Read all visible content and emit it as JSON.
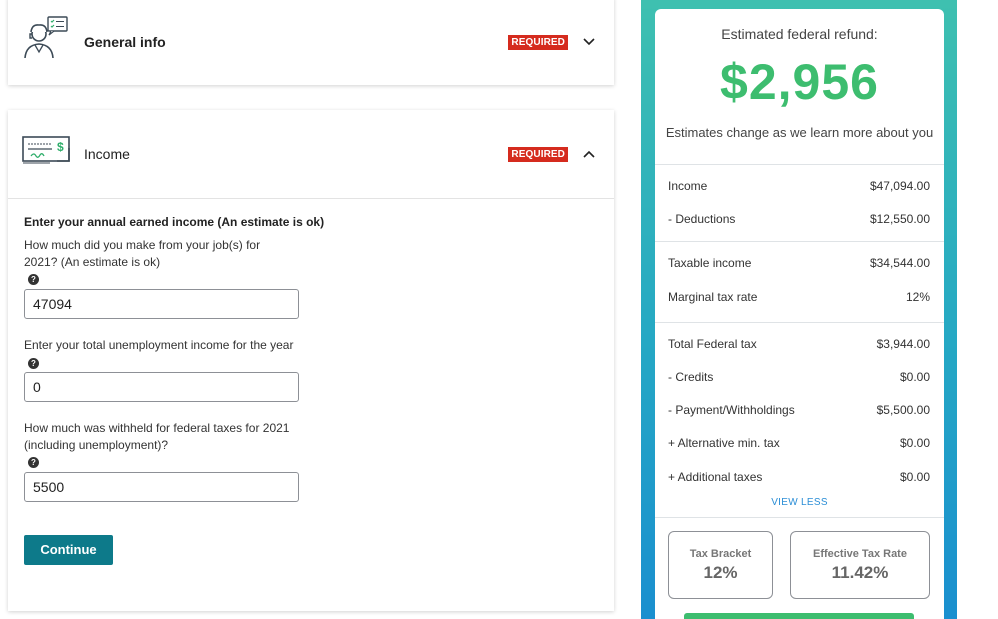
{
  "general_card": {
    "title": "General info",
    "badge": "REQUIRED",
    "icon": "person-chat-icon"
  },
  "income_card": {
    "title": "Income",
    "badge": "REQUIRED",
    "icon": "check-dollar-icon",
    "heading": "Enter your annual earned income (An estimate is ok)",
    "questions": [
      {
        "label": "How much did you make from your job(s) for 2021? (An estimate is ok)",
        "value": "47094"
      },
      {
        "label": "Enter your total unemployment income for the year",
        "value": "0"
      },
      {
        "label": "How much was withheld for federal taxes for 2021 (including unemployment)?",
        "value": "5500"
      }
    ],
    "help_glyph": "?",
    "continue_label": "Continue"
  },
  "summary": {
    "refund_label": "Estimated federal refund:",
    "refund_value": "$2,956",
    "refund_note": "Estimates change as we learn more about you",
    "rows": [
      {
        "label": "Income",
        "value": "$47,094.00"
      },
      {
        "label": "- Deductions",
        "value": "$12,550.00"
      },
      {
        "label": "Taxable income",
        "value": "$34,544.00"
      },
      {
        "label": "Marginal tax rate",
        "value": "12%"
      },
      {
        "label": "Total Federal tax",
        "value": "$3,944.00"
      },
      {
        "label": "- Credits",
        "value": "$0.00"
      },
      {
        "label": "- Payment/Withholdings",
        "value": "$5,500.00"
      },
      {
        "label": "+ Alternative min. tax",
        "value": "$0.00"
      },
      {
        "label": "+ Additional taxes",
        "value": "$0.00"
      }
    ],
    "view_less": "VIEW LESS",
    "tiles": [
      {
        "label": "Tax Bracket",
        "value": "12%"
      },
      {
        "label": "Effective Tax Rate",
        "value": "11.42%"
      }
    ]
  },
  "colors": {
    "accent_green": "#3dbd6f",
    "required_red": "#d52b1e",
    "continue_teal": "#0d7a8a",
    "link_blue": "#2b8ed6"
  }
}
